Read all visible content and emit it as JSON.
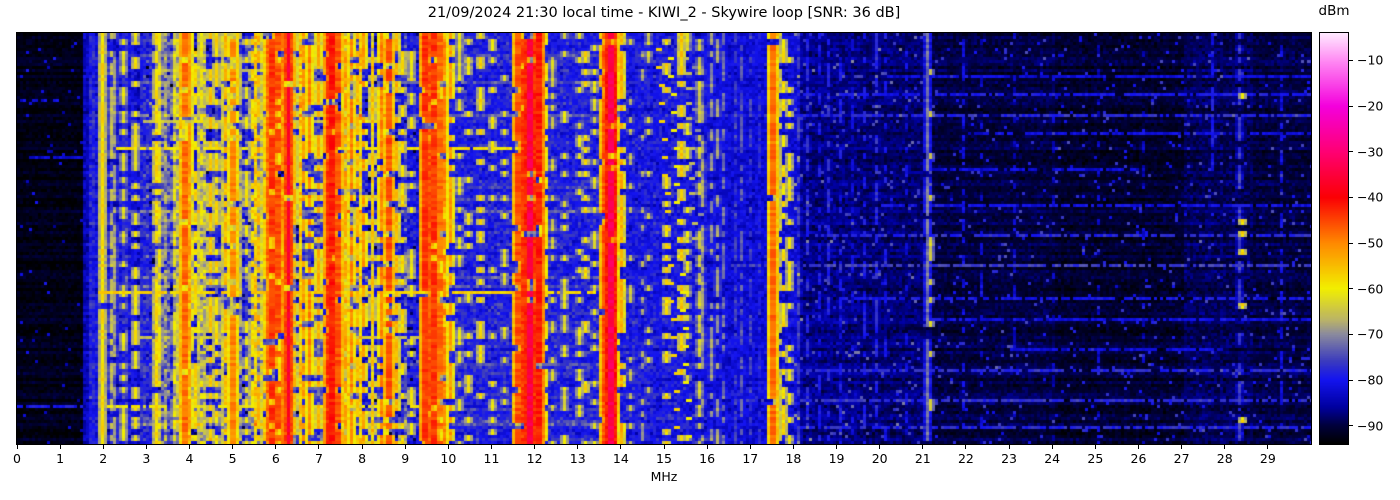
{
  "figure": {
    "title": "21/09/2024 21:30 local time - KIWI_2 - Skywire loop [SNR: 36 dB]"
  },
  "x_axis": {
    "label": "MHz",
    "range_mhz": [
      0,
      30
    ],
    "tick_labels": [
      "0",
      "1",
      "2",
      "3",
      "4",
      "5",
      "6",
      "7",
      "8",
      "9",
      "10",
      "11",
      "12",
      "13",
      "14",
      "15",
      "16",
      "17",
      "18",
      "19",
      "20",
      "21",
      "22",
      "23",
      "24",
      "25",
      "26",
      "27",
      "28",
      "29"
    ]
  },
  "colorbar": {
    "label": "dBm",
    "vmax_dbm": -4,
    "vmin_dbm": -94,
    "ticks": [
      {
        "value": -10,
        "label": "−10"
      },
      {
        "value": -20,
        "label": "−20"
      },
      {
        "value": -30,
        "label": "−30"
      },
      {
        "value": -40,
        "label": "−40"
      },
      {
        "value": -50,
        "label": "−50"
      },
      {
        "value": -60,
        "label": "−60"
      },
      {
        "value": -70,
        "label": "−70"
      },
      {
        "value": -80,
        "label": "−80"
      },
      {
        "value": -90,
        "label": "−90"
      }
    ]
  },
  "chart_data": {
    "type": "heatmap",
    "title": "21/09/2024 21:30 local time - KIWI_2 - Skywire loop [SNR: 36 dB]",
    "xlabel": "MHz",
    "ylabel": "",
    "x_range_mhz": [
      0,
      30
    ],
    "colorbar_label": "dBm",
    "value_range_dbm": [
      -94,
      -4
    ],
    "colorbar_ticks_dbm": [
      -10,
      -20,
      -30,
      -40,
      -50,
      -60,
      -70,
      -80,
      -90
    ],
    "grid": false,
    "legend": "colorbar-right",
    "colormap_stops": [
      [
        0.0,
        "#ffe9ff"
      ],
      [
        0.067,
        "#ff8af3"
      ],
      [
        0.178,
        "#f400dc"
      ],
      [
        0.289,
        "#ff0073"
      ],
      [
        0.4,
        "#fb0004"
      ],
      [
        0.511,
        "#ff8900"
      ],
      [
        0.622,
        "#f2ef00"
      ],
      [
        0.7,
        "#b9b269"
      ],
      [
        0.733,
        "#8b8b9d"
      ],
      [
        0.8,
        "#3a3abf"
      ],
      [
        0.844,
        "#1414f0"
      ],
      [
        0.911,
        "#0000a0"
      ],
      [
        0.956,
        "#00003c"
      ],
      [
        1.0,
        "#000000"
      ]
    ],
    "noise_floor_fields": [
      "f_start_mhz",
      "f_end_mhz",
      "dbm",
      "variance_db"
    ],
    "noise_floor_profile": [
      [
        0.0,
        1.55,
        -92.5,
        2.0
      ],
      [
        1.55,
        1.7,
        -84,
        4.0
      ],
      [
        1.7,
        2.9,
        -80,
        5.0
      ],
      [
        2.9,
        3.3,
        -78,
        6.0
      ],
      [
        3.3,
        9.0,
        -76,
        7.0
      ],
      [
        9.0,
        9.35,
        -80,
        5.0
      ],
      [
        9.35,
        10.05,
        -75,
        6.0
      ],
      [
        10.05,
        11.55,
        -79,
        5.0
      ],
      [
        11.55,
        12.25,
        -74,
        6.0
      ],
      [
        12.25,
        13.45,
        -79,
        5.0
      ],
      [
        13.45,
        13.95,
        -74,
        6.0
      ],
      [
        13.95,
        15.7,
        -80,
        5.0
      ],
      [
        15.7,
        16.45,
        -82,
        4.0
      ],
      [
        16.45,
        18.15,
        -82,
        4.0
      ],
      [
        18.15,
        19.5,
        -87,
        3.5
      ],
      [
        19.5,
        21.2,
        -88,
        3.0
      ],
      [
        21.2,
        24.0,
        -90,
        2.5
      ],
      [
        24.0,
        27.0,
        -91,
        2.5
      ],
      [
        27.0,
        28.6,
        -89,
        3.0
      ],
      [
        28.6,
        30.0,
        -90,
        2.5
      ]
    ],
    "stations_fields": [
      "mhz",
      "dbm",
      "width_cells",
      "duty",
      "row_start_frac",
      "row_end_frac"
    ],
    "stations": [
      [
        2.0,
        -58,
        1,
        0.97
      ],
      [
        2.17,
        -66,
        1,
        0.65
      ],
      [
        2.27,
        -68,
        1,
        0.7
      ],
      [
        2.46,
        -62,
        1,
        0.5
      ],
      [
        2.76,
        -60,
        1,
        0.5
      ],
      [
        3.2,
        -58,
        1,
        0.8
      ],
      [
        3.33,
        -60,
        1,
        0.6
      ],
      [
        3.62,
        -62,
        1,
        0.5
      ],
      [
        3.75,
        -55,
        1,
        0.7
      ],
      [
        3.9,
        -48,
        2,
        0.9
      ],
      [
        3.99,
        -52,
        1,
        0.8
      ],
      [
        4.15,
        -58,
        1,
        0.6
      ],
      [
        4.3,
        -60,
        1,
        0.5
      ],
      [
        4.47,
        -56,
        1,
        0.6
      ],
      [
        4.65,
        -58,
        1,
        0.5
      ],
      [
        4.8,
        -55,
        1,
        0.7
      ],
      [
        5.0,
        -50,
        2,
        0.8
      ],
      [
        5.13,
        -57,
        1,
        0.5
      ],
      [
        5.3,
        -60,
        1,
        0.4
      ],
      [
        5.45,
        -58,
        1,
        0.5
      ],
      [
        5.6,
        -55,
        1,
        0.6
      ],
      [
        5.8,
        -48,
        1,
        0.8
      ],
      [
        5.93,
        -44,
        2,
        0.9
      ],
      [
        6.07,
        -46,
        2,
        0.85
      ],
      [
        6.18,
        -50,
        1,
        0.8
      ],
      [
        6.27,
        -36,
        1,
        0.9
      ],
      [
        6.43,
        -55,
        1,
        0.6
      ],
      [
        6.6,
        -52,
        1,
        0.7
      ],
      [
        6.8,
        -50,
        1,
        0.7
      ],
      [
        7.0,
        -54,
        1,
        0.6
      ],
      [
        7.22,
        -44,
        2,
        0.9
      ],
      [
        7.32,
        -42,
        2,
        0.95
      ],
      [
        7.44,
        -46,
        2,
        0.85
      ],
      [
        7.58,
        -52,
        1,
        0.7
      ],
      [
        7.75,
        -50,
        1,
        0.7
      ],
      [
        7.9,
        -55,
        1,
        0.5
      ],
      [
        8.05,
        -52,
        1,
        0.6
      ],
      [
        8.25,
        -56,
        1,
        0.5
      ],
      [
        8.45,
        -50,
        1,
        0.7
      ],
      [
        8.6,
        -46,
        2,
        0.8
      ],
      [
        8.75,
        -54,
        1,
        0.5
      ],
      [
        8.95,
        -58,
        1,
        0.4
      ],
      [
        9.15,
        -60,
        1,
        0.4
      ],
      [
        9.41,
        -44,
        2,
        0.9
      ],
      [
        9.53,
        -46,
        2,
        0.85
      ],
      [
        9.65,
        -44,
        2,
        0.9
      ],
      [
        9.8,
        -48,
        2,
        0.8
      ],
      [
        9.9,
        -50,
        1,
        0.8
      ],
      [
        10.0,
        -52,
        1,
        0.6
      ],
      [
        10.25,
        -62,
        1,
        0.4
      ],
      [
        10.45,
        -60,
        1,
        0.4
      ],
      [
        10.7,
        -58,
        1,
        0.4
      ],
      [
        11.0,
        -60,
        1,
        0.4
      ],
      [
        11.25,
        -62,
        1,
        0.3
      ],
      [
        11.63,
        -46,
        2,
        0.85
      ],
      [
        11.77,
        -44,
        2,
        0.9
      ],
      [
        11.9,
        -34,
        2,
        0.95
      ],
      [
        12.05,
        -42,
        2,
        0.9
      ],
      [
        12.16,
        -50,
        1,
        0.7
      ],
      [
        12.4,
        -64,
        1,
        0.3
      ],
      [
        12.7,
        -62,
        1,
        0.3
      ],
      [
        13.0,
        -62,
        1,
        0.3
      ],
      [
        13.15,
        -58,
        1,
        0.35
      ],
      [
        13.35,
        -62,
        1,
        0.3
      ],
      [
        13.6,
        -46,
        2,
        0.8
      ],
      [
        13.7,
        -44,
        2,
        0.85
      ],
      [
        13.78,
        -33,
        2,
        0.95
      ],
      [
        13.87,
        -48,
        1,
        0.8
      ],
      [
        14.0,
        -54,
        1,
        0.7
      ],
      [
        14.2,
        -66,
        1,
        0.3
      ],
      [
        14.45,
        -68,
        1,
        0.3
      ],
      [
        14.65,
        -64,
        1,
        0.3
      ],
      [
        15.05,
        -58,
        1,
        0.35
      ],
      [
        15.35,
        -56,
        1,
        0.5
      ],
      [
        15.55,
        -62,
        1,
        0.4
      ],
      [
        15.8,
        -64,
        1,
        0.5
      ],
      [
        15.9,
        -68,
        1,
        0.5
      ],
      [
        16.08,
        -69,
        1,
        0.55
      ],
      [
        16.2,
        -69,
        1,
        0.5
      ],
      [
        16.33,
        -72,
        1,
        0.5
      ],
      [
        16.6,
        -76,
        1,
        0.6
      ],
      [
        16.8,
        -74,
        1,
        0.6
      ],
      [
        17.0,
        -76,
        1,
        0.5
      ],
      [
        17.2,
        -78,
        1,
        0.5
      ],
      [
        17.48,
        -48,
        2,
        0.97
      ],
      [
        17.58,
        -56,
        1,
        0.6
      ],
      [
        17.73,
        -58,
        1,
        0.45
      ],
      [
        17.9,
        -60,
        1,
        0.4
      ],
      [
        18.1,
        -76,
        1,
        0.5
      ],
      [
        18.3,
        -78,
        1,
        0.6
      ],
      [
        18.55,
        -80,
        1,
        0.5
      ],
      [
        18.8,
        -78,
        1,
        0.5
      ],
      [
        19.05,
        -80,
        1,
        0.4
      ],
      [
        19.35,
        -82,
        1,
        0.4
      ],
      [
        19.65,
        -80,
        1,
        0.4
      ],
      [
        19.9,
        -78,
        1,
        0.5
      ],
      [
        20.1,
        -80,
        1,
        0.4
      ],
      [
        20.6,
        -82,
        1,
        0.3
      ],
      [
        21.05,
        -72,
        1,
        0.85
      ],
      [
        21.12,
        -64,
        1,
        0.25
      ],
      [
        21.9,
        -82,
        1,
        0.4
      ],
      [
        22.3,
        -84,
        1,
        0.3
      ],
      [
        23.1,
        -84,
        1,
        0.3
      ],
      [
        24.0,
        -84,
        1,
        0.25
      ],
      [
        25.0,
        -84,
        1,
        0.25
      ],
      [
        26.1,
        -84,
        1,
        0.2
      ],
      [
        27.65,
        -80,
        1,
        0.7,
        0.0,
        0.33
      ],
      [
        28.3,
        -76,
        1,
        0.6
      ],
      [
        28.38,
        -58,
        1,
        0.12
      ],
      [
        29.3,
        -82,
        1,
        0.4
      ]
    ],
    "streaks_fields": [
      "row_frac",
      "f_start_mhz",
      "f_end_mhz",
      "dbm"
    ],
    "horizontal_streaks": [
      [
        0.085,
        3.3,
        6.5,
        -66
      ],
      [
        0.21,
        2.9,
        8.2,
        -65
      ],
      [
        0.277,
        2.3,
        12.2,
        -59
      ],
      [
        0.455,
        3.1,
        7.2,
        -67
      ],
      [
        0.632,
        1.9,
        13.4,
        -57
      ],
      [
        0.74,
        2.7,
        9.4,
        -65
      ],
      [
        0.915,
        2.1,
        9.6,
        -61
      ],
      [
        0.1,
        20.0,
        30.0,
        -82
      ],
      [
        0.15,
        18.0,
        30.0,
        -80
      ],
      [
        0.195,
        16.0,
        30.0,
        -78
      ],
      [
        0.24,
        22.0,
        30.0,
        -82
      ],
      [
        0.33,
        21.0,
        26.0,
        -82
      ],
      [
        0.42,
        20.0,
        30.0,
        -81
      ],
      [
        0.49,
        18.5,
        30.0,
        -78
      ],
      [
        0.565,
        16.5,
        30.0,
        -76
      ],
      [
        0.645,
        19.0,
        30.0,
        -80
      ],
      [
        0.7,
        21.0,
        30.0,
        -81
      ],
      [
        0.77,
        23.0,
        28.0,
        -82
      ],
      [
        0.82,
        18.0,
        30.0,
        -78
      ],
      [
        0.9,
        16.5,
        30.0,
        -77
      ],
      [
        0.965,
        18.0,
        30.0,
        -78
      ],
      [
        0.16,
        0.1,
        1.0,
        -82
      ],
      [
        0.3,
        0.3,
        1.5,
        -83
      ],
      [
        0.91,
        0.0,
        1.5,
        -80
      ]
    ],
    "diagonal_tracks_fields": [
      "f_start_mhz",
      "drift_cells_per_row",
      "period_rows",
      "phase",
      "dbm",
      "row_start_frac",
      "row_end_frac"
    ],
    "diagonal_tracks": [
      [
        14.8,
        0.05,
        6,
        1,
        -57,
        0.02,
        1.0
      ],
      [
        15.06,
        0.05,
        6,
        4,
        -60,
        0.06,
        1.0
      ],
      [
        15.4,
        0.04,
        5,
        2,
        -66,
        0.0,
        0.52
      ],
      [
        15.6,
        0.035,
        7,
        3,
        -70,
        0.08,
        0.62
      ]
    ]
  }
}
